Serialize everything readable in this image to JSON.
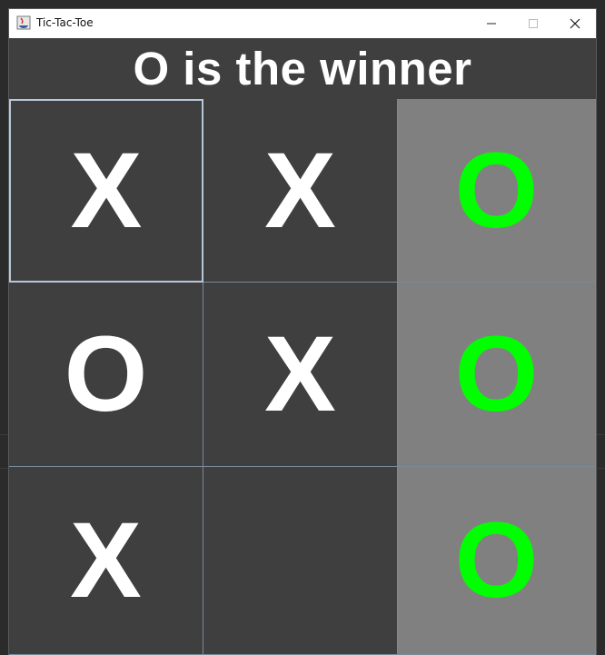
{
  "window": {
    "title": "Tic-Tac-Toe"
  },
  "status": {
    "message": "O is the winner"
  },
  "colors": {
    "board_bg": "#3f3f3f",
    "win_cell_bg": "#808080",
    "mark_default": "#ffffff",
    "mark_winning": "#00ff00",
    "grid_line": "#7a8a99"
  },
  "board": {
    "cells": [
      {
        "mark": "X",
        "winning": false
      },
      {
        "mark": "X",
        "winning": false
      },
      {
        "mark": "O",
        "winning": true
      },
      {
        "mark": "O",
        "winning": false
      },
      {
        "mark": "X",
        "winning": false
      },
      {
        "mark": "O",
        "winning": true
      },
      {
        "mark": "X",
        "winning": false
      },
      {
        "mark": "",
        "winning": false
      },
      {
        "mark": "O",
        "winning": true
      }
    ]
  }
}
